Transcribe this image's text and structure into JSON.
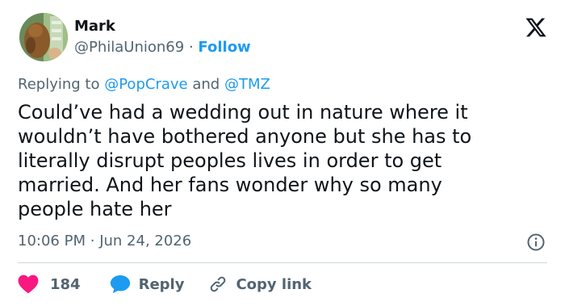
{
  "author": {
    "name": "Mark",
    "handle": "@PhilaUnion69",
    "separator": "·",
    "follow_label": "Follow"
  },
  "reply_context": {
    "prefix": "Replying to",
    "mention_1": "@PopCrave",
    "conjunction": "and",
    "mention_2": "@TMZ"
  },
  "tweet": {
    "text": "Could’ve had a wedding out in nature where it\nwouldn’t have bothered anyone but she has to\nliterally disrupt peoples lives in order to get\nmarried.  And her fans wonder why so many\npeople hate her",
    "time": "10:06 PM",
    "separator": "·",
    "date": "Jun 24, 2026"
  },
  "actions": {
    "like_count": "184",
    "reply_label": "Reply",
    "copy_label": "Copy link"
  },
  "icons": {
    "brand": "x-logo-icon",
    "info": "info-icon",
    "like": "heart-icon",
    "reply": "speech-bubble-icon",
    "copy": "link-icon"
  },
  "colors": {
    "accent": "#1d9bf0",
    "like": "#f91880",
    "text": "#0f1419",
    "muted": "#536471",
    "divider": "#cfd9de"
  }
}
